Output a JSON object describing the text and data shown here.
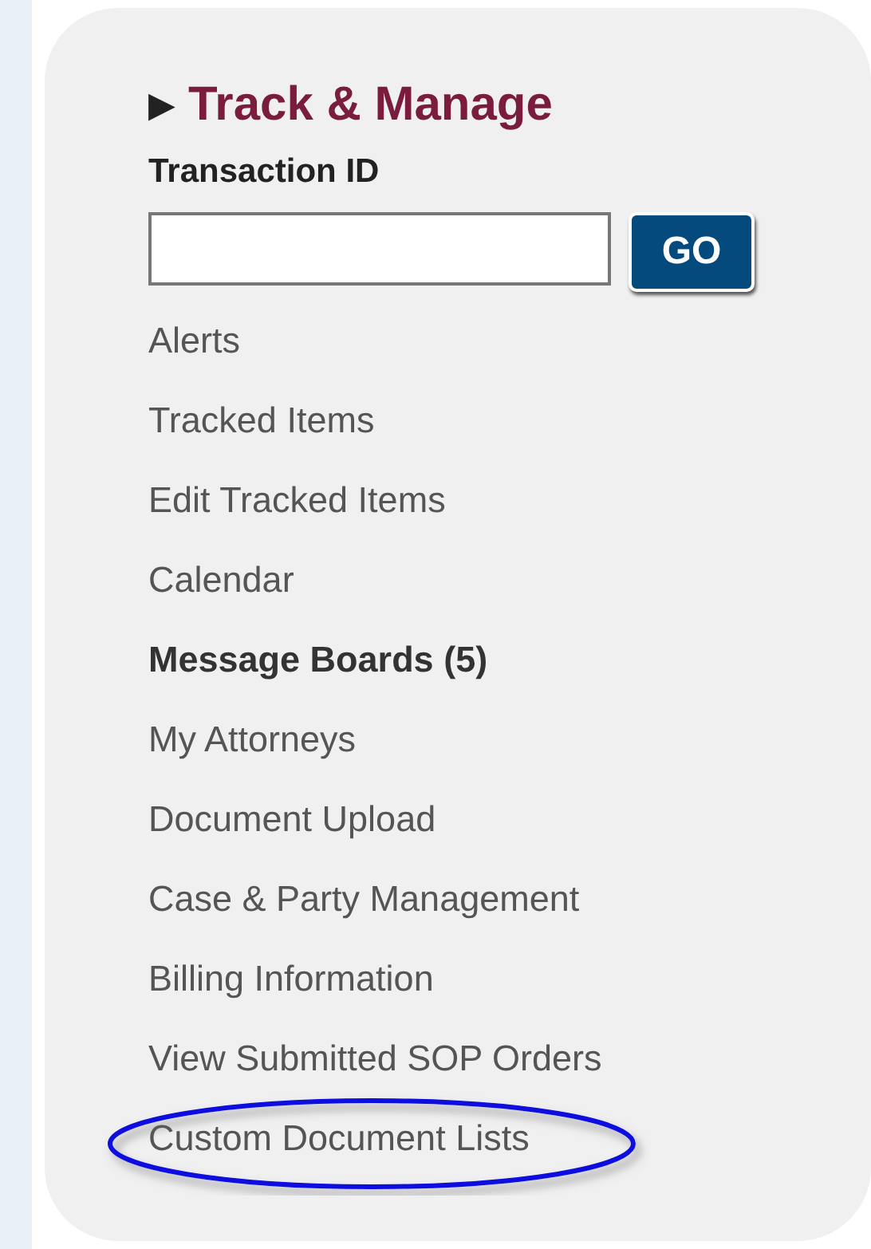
{
  "panel": {
    "arrow": "▶",
    "title": "Track & Manage",
    "field_label": "Transaction ID",
    "button": "GO",
    "items": [
      {
        "label": "Alerts",
        "bold": false,
        "circled": false
      },
      {
        "label": "Tracked Items",
        "bold": false,
        "circled": false
      },
      {
        "label": "Edit Tracked Items",
        "bold": false,
        "circled": false
      },
      {
        "label": "Calendar",
        "bold": false,
        "circled": false
      },
      {
        "label": "Message Boards (5)",
        "bold": true,
        "circled": false
      },
      {
        "label": "My Attorneys",
        "bold": false,
        "circled": false
      },
      {
        "label": "Document Upload",
        "bold": false,
        "circled": false
      },
      {
        "label": "Case & Party Management",
        "bold": false,
        "circled": false
      },
      {
        "label": "Billing Information",
        "bold": false,
        "circled": false
      },
      {
        "label": "View Submitted SOP Orders",
        "bold": false,
        "circled": false
      },
      {
        "label": "Custom Document Lists",
        "bold": false,
        "circled": true
      }
    ]
  }
}
